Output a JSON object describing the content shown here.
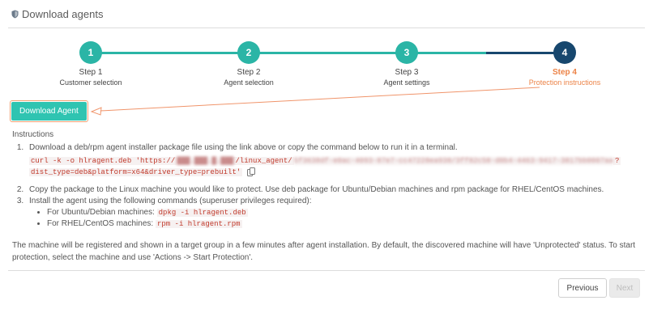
{
  "header": {
    "title": "Download agents",
    "icon": "shield-icon"
  },
  "steps": [
    {
      "label": "Step 1",
      "sublabel": "Customer selection",
      "number": "1",
      "status": "done"
    },
    {
      "label": "Step 2",
      "sublabel": "Agent selection",
      "number": "2",
      "status": "done"
    },
    {
      "label": "Step 3",
      "sublabel": "Agent settings",
      "number": "3",
      "status": "done"
    },
    {
      "label": "Step 4",
      "sublabel": "Protection instructions",
      "number": "4",
      "status": "active"
    }
  ],
  "colors": {
    "completed": "#2bb5a6",
    "active_circle": "#17476e",
    "active_text": "#ec8347",
    "button": "#2fc4b1"
  },
  "download_button_label": "Download Agent",
  "instructions": {
    "title": "Instructions",
    "step1": "Download a deb/rpm agent installer package file using the link above or copy the command below to run it in a terminal.",
    "cmd_prefix": "curl -k -o hlragent.deb 'https://",
    "cmd_host_redacted": "███.███.█.███",
    "cmd_path": "/linux_agent/",
    "cmd_token_redacted": "5f3638df-e0ac-4093-87e7-cc47228ea938/3ff82c58-d0b4-4463-9417-3817bb0007aa",
    "cmd_suffix": "?",
    "cmd_line2": "dist_type=deb&platform=x64&driver_type=prebuilt'",
    "step2": "Copy the package to the Linux machine you would like to protect. Use deb package for Ubuntu/Debian machines and rpm package for RHEL/CentOS machines.",
    "step3": "Install the agent using the following commands (superuser privileges required):",
    "ubuntu_label": "For Ubuntu/Debian machines:",
    "ubuntu_cmd": "dpkg -i hlragent.deb",
    "rhel_label": "For RHEL/CentOS machines:",
    "rhel_cmd": "rpm -i hlragent.rpm"
  },
  "footnote": "The machine will be registered and shown in a target group in a few minutes after agent installation. By default, the discovered machine will have 'Unprotected' status. To start protection, select the machine and use 'Actions -> Start Protection'.",
  "footer": {
    "previous": "Previous",
    "next": "Next"
  }
}
